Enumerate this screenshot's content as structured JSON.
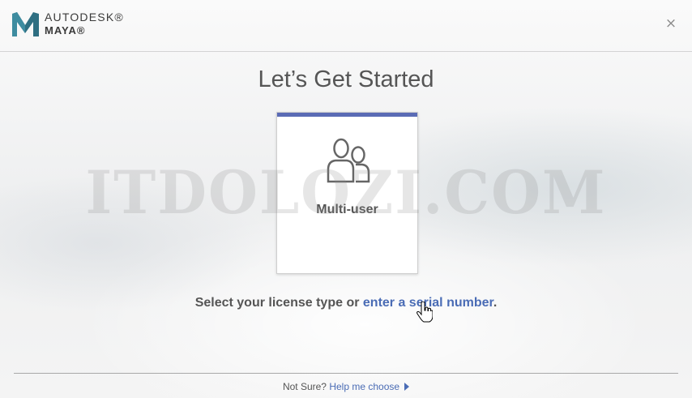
{
  "header": {
    "brand_top": "AUTODESK®",
    "brand_sub": "MAYA®",
    "close_glyph": "×"
  },
  "title": "Let’s Get Started",
  "card": {
    "label": "Multi-user",
    "icon": "multi-user-icon",
    "accent_color": "#5a6bb5"
  },
  "watermark": "ITDOLOZI.COM",
  "prompt": {
    "text": "Select your license type or",
    "link": "enter a serial number",
    "end": "."
  },
  "footer": {
    "not_sure": "Not Sure?",
    "help_link": "Help me choose"
  },
  "colors": {
    "link": "#4a6cb5",
    "text": "#555555"
  }
}
